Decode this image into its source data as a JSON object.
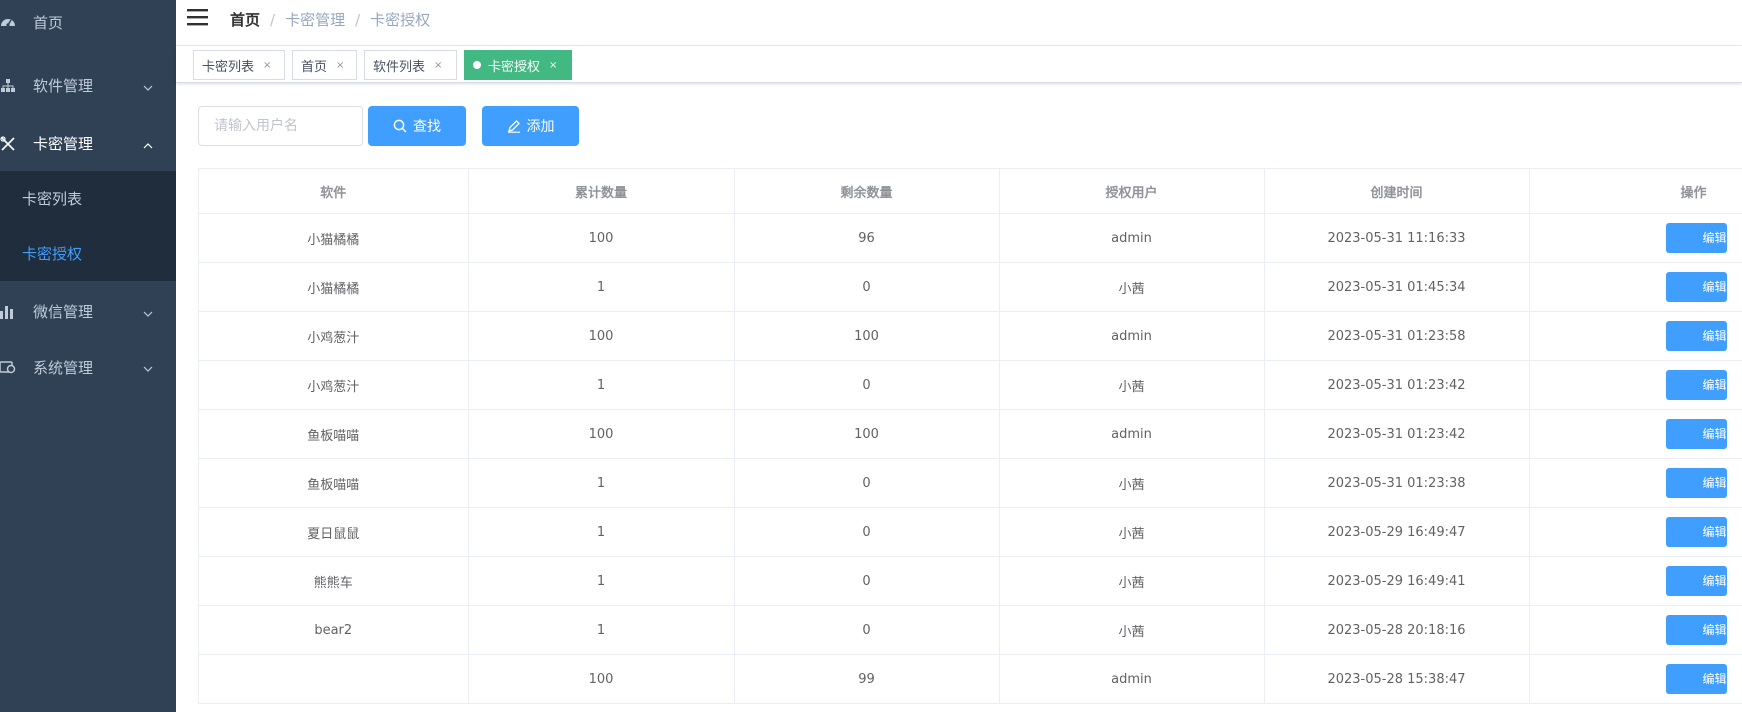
{
  "sidebar": {
    "items": [
      {
        "label": "首页",
        "icon": "dashboard-icon"
      },
      {
        "label": "软件管理",
        "icon": "tree-icon"
      },
      {
        "label": "卡密管理",
        "icon": "tools-icon",
        "expanded": true,
        "children": [
          {
            "label": "卡密列表"
          },
          {
            "label": "卡密授权",
            "active": true
          }
        ]
      },
      {
        "label": "微信管理",
        "icon": "bar-chart-icon"
      },
      {
        "label": "系统管理",
        "icon": "settings-icon"
      }
    ]
  },
  "navbar": {
    "breadcrumb": [
      "首页",
      "卡密管理",
      "卡密授权"
    ],
    "separator": "/"
  },
  "tags": [
    {
      "label": "卡密列表",
      "close": "×"
    },
    {
      "label": "首页",
      "close": "×"
    },
    {
      "label": "软件列表",
      "close": "×"
    },
    {
      "label": "卡密授权",
      "close": "×",
      "active": true
    }
  ],
  "toolbar": {
    "search_placeholder": "请输入用户名",
    "search_value": "",
    "search_label": "查找",
    "add_label": "添加"
  },
  "table": {
    "columns": [
      "软件",
      "累计数量",
      "剩余数量",
      "授权用户",
      "创建时间",
      "操作"
    ],
    "edit_label": "编辑",
    "rows": [
      [
        "小猫橘橘",
        "100",
        "96",
        "admin",
        "2023-05-31 11:16:33"
      ],
      [
        "小猫橘橘",
        "1",
        "0",
        "小茜",
        "2023-05-31 01:45:34"
      ],
      [
        "小鸡葱汁",
        "100",
        "100",
        "admin",
        "2023-05-31 01:23:58"
      ],
      [
        "小鸡葱汁",
        "1",
        "0",
        "小茜",
        "2023-05-31 01:23:42"
      ],
      [
        "鱼板喵喵",
        "100",
        "100",
        "admin",
        "2023-05-31 01:23:42"
      ],
      [
        "鱼板喵喵",
        "1",
        "0",
        "小茜",
        "2023-05-31 01:23:38"
      ],
      [
        "夏日鼠鼠",
        "1",
        "0",
        "小茜",
        "2023-05-29 16:49:47"
      ],
      [
        "熊熊车",
        "1",
        "0",
        "小茜",
        "2023-05-29 16:49:41"
      ],
      [
        "bear2",
        "1",
        "0",
        "小茜",
        "2023-05-28 20:18:16"
      ],
      [
        "",
        "100",
        "99",
        "admin",
        "2023-05-28 15:38:47"
      ]
    ]
  },
  "colors": {
    "sidebar_bg": "#304156",
    "submenu_bg": "#1f2d3d",
    "primary": "#409eff",
    "active_tag": "#42b983"
  }
}
